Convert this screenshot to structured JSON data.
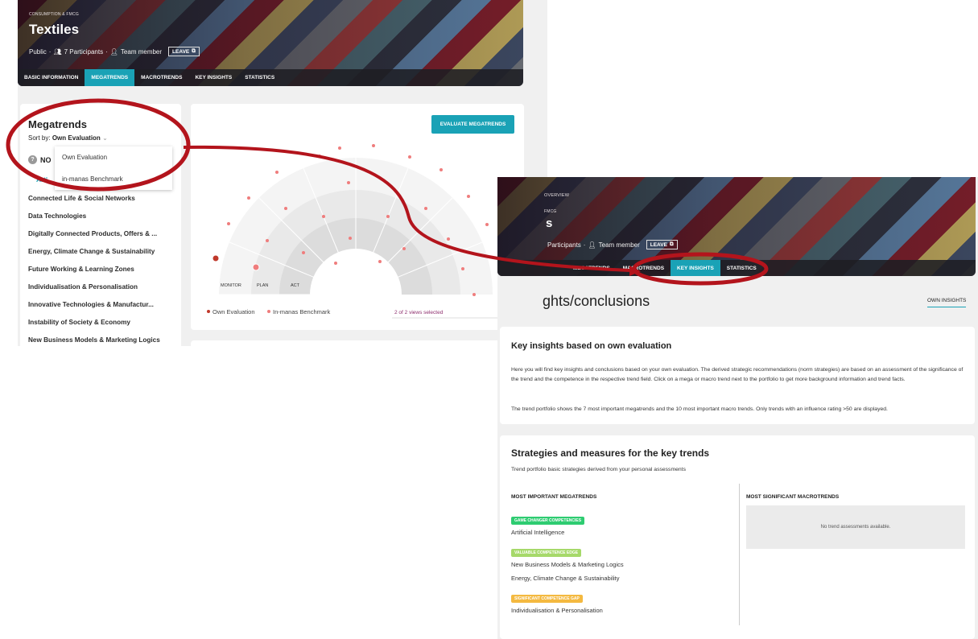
{
  "left": {
    "hero": {
      "kicker": "CONSUMPTION & FMCG",
      "title": "Textiles",
      "visibility": "Public",
      "participants": "7 Participants",
      "role": "Team member",
      "leave": "LEAVE"
    },
    "tabs": [
      "BASIC INFORMATION",
      "MEGATRENDS",
      "MACROTRENDS",
      "KEY INSIGHTS",
      "STATISTICS"
    ],
    "active_tab": "MEGATRENDS",
    "sidebar": {
      "title": "Megatrends",
      "sort_label": "Sort by:",
      "sort_value": "Own Evaluation",
      "group_label": "NO",
      "first_item": "Arti",
      "items": [
        "Connected Life & Social Networks",
        "Data Technologies",
        "Digitally Connected Products, Offers & ...",
        "Energy, Climate Change & Sustainability",
        "Future Working & Learning Zones",
        "Individualisation & Personalisation",
        "Innovative Technologies & Manufactur...",
        "Instability of Society & Economy",
        "New Business Models & Marketing Logics"
      ],
      "dropdown_options": [
        "Own Evaluation",
        "in-manas Benchmark"
      ]
    },
    "chart": {
      "button": "EVALUATE MEGATRENDS",
      "ring_labels": [
        "MONITOR",
        "PLAN",
        "ACT"
      ],
      "legend": [
        "Own Evaluation",
        "In-manas Benchmark"
      ],
      "views": "2 of 2 views selected"
    }
  },
  "right": {
    "hero": {
      "overview": "OVERVIEW",
      "kicker": "FMCG",
      "title": "s",
      "participants": "Participants",
      "role": "Team member",
      "leave": "LEAVE"
    },
    "tabs": [
      "MEGATRENDS",
      "MACROTRENDS",
      "KEY INSIGHTS",
      "STATISTICS"
    ],
    "active_tab": "KEY INSIGHTS",
    "page_title": "ghts/conclusions",
    "own_insights": "OWN INSIGHTS",
    "insights": {
      "title": "Key insights based on own evaluation",
      "p1": "Here you will find key insights and conclusions based on your own evaluation. The derived strategic recommendations (norm strategies) are based on an assessment of the significance of the trend and the competence in the respective trend field. Click on a mega or macro trend next to the portfolio to get more background information and trend facts.",
      "p2": "The trend portfolio shows the 7 most important megatrends and the 10 most important macro trends. Only trends with an influence rating >50 are displayed."
    },
    "strategies": {
      "title": "Strategies and measures for the key trends",
      "subtitle": "Trend portfolio basic strategies derived from your personal assessments",
      "mega_header": "MOST IMPORTANT MEGATRENDS",
      "macro_header": "MOST SIGNIFICANT MACROTRENDS",
      "no_data": "No trend assessments available.",
      "groups": [
        {
          "badge": "GAME CHANGER COMPETENCIES",
          "color": "#2ecc71",
          "trends": [
            "Artificial Intelligence"
          ]
        },
        {
          "badge": "VALUABLE COMPETENCE EDGE",
          "color": "#a6d96a",
          "trends": [
            "New Business Models & Marketing Logics",
            "Energy, Climate Change & Sustainability"
          ]
        },
        {
          "badge": "SIGNIFICANT COMPETENCE GAP",
          "color": "#f4b940",
          "trends": [
            "Individualisation & Personalisation"
          ]
        }
      ]
    }
  },
  "colors": {
    "accent": "#1aa2b6",
    "annotation": "#b3141c",
    "own_point": "#c0392b",
    "bench_point": "#ef7d7d"
  }
}
